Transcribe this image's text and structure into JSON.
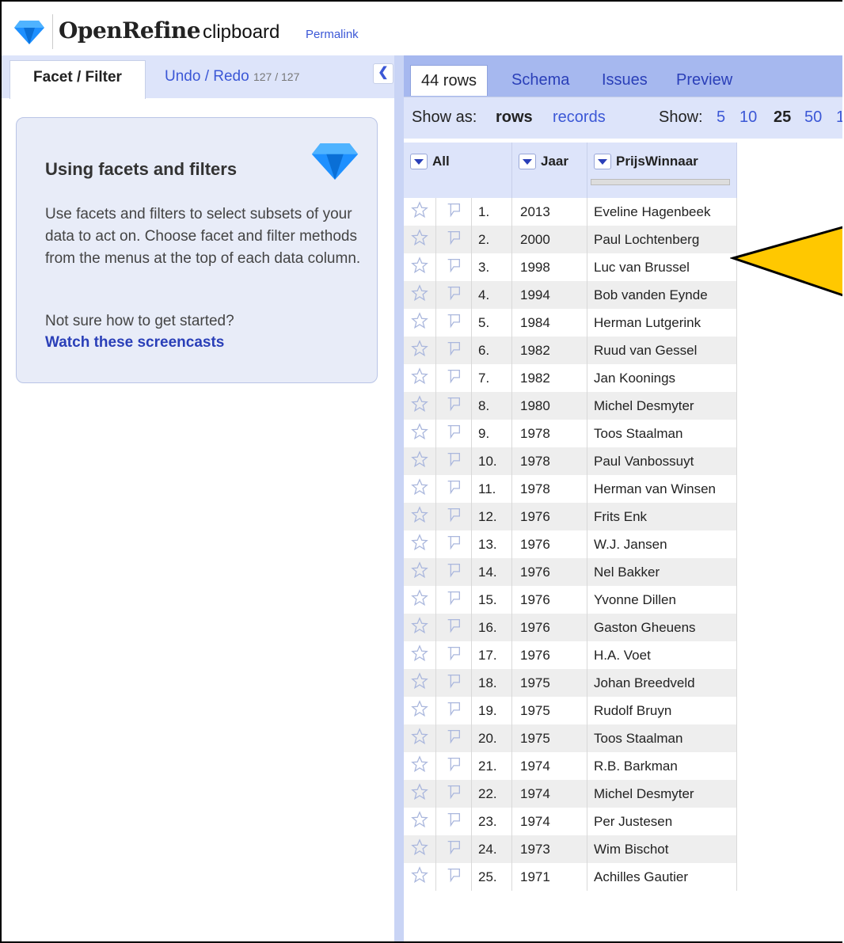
{
  "header": {
    "app_name": "OpenRefine",
    "project_name": "clipboard",
    "permalink": "Permalink"
  },
  "left_panel": {
    "tab_facet": "Facet / Filter",
    "tab_undo": "Undo / Redo",
    "undo_count": "127 / 127",
    "collapse_icon": "chevron-left-icon",
    "help": {
      "title": "Using facets and filters",
      "body": "Use facets and filters to select subsets of your data to act on. Choose facet and filter methods from the menus at the top of each data column.",
      "question": "Not sure how to get started?",
      "link": "Watch these screencasts"
    }
  },
  "right_panel": {
    "tabs": {
      "rows": "44 rows",
      "schema": "Schema",
      "issues": "Issues",
      "preview": "Preview"
    },
    "viewbar": {
      "show_as_label": "Show as:",
      "rows": "rows",
      "records": "records",
      "show_label": "Show:",
      "opt5": "5",
      "opt10": "10",
      "opt25": "25",
      "opt50": "50",
      "opt_more": "1"
    },
    "columns": {
      "all": "All",
      "jaar": "Jaar",
      "prijswinnaar": "PrijsWinnaar"
    },
    "rows": [
      {
        "n": "1.",
        "jaar": "2013",
        "naam": "Eveline Hagenbeek"
      },
      {
        "n": "2.",
        "jaar": "2000",
        "naam": "Paul Lochtenberg"
      },
      {
        "n": "3.",
        "jaar": "1998",
        "naam": "Luc van Brussel"
      },
      {
        "n": "4.",
        "jaar": "1994",
        "naam": "Bob vanden Eynde"
      },
      {
        "n": "5.",
        "jaar": "1984",
        "naam": "Herman Lutgerink"
      },
      {
        "n": "6.",
        "jaar": "1982",
        "naam": "Ruud van Gessel"
      },
      {
        "n": "7.",
        "jaar": "1982",
        "naam": "Jan Koonings"
      },
      {
        "n": "8.",
        "jaar": "1980",
        "naam": "Michel Desmyter"
      },
      {
        "n": "9.",
        "jaar": "1978",
        "naam": "Toos Staalman"
      },
      {
        "n": "10.",
        "jaar": "1978",
        "naam": "Paul Vanbossuyt"
      },
      {
        "n": "11.",
        "jaar": "1978",
        "naam": "Herman van Winsen"
      },
      {
        "n": "12.",
        "jaar": "1976",
        "naam": "Frits Enk"
      },
      {
        "n": "13.",
        "jaar": "1976",
        "naam": "W.J. Jansen"
      },
      {
        "n": "14.",
        "jaar": "1976",
        "naam": "Nel Bakker"
      },
      {
        "n": "15.",
        "jaar": "1976",
        "naam": "Yvonne Dillen"
      },
      {
        "n": "16.",
        "jaar": "1976",
        "naam": "Gaston Gheuens"
      },
      {
        "n": "17.",
        "jaar": "1976",
        "naam": "H.A. Voet"
      },
      {
        "n": "18.",
        "jaar": "1975",
        "naam": "Johan Breedveld"
      },
      {
        "n": "19.",
        "jaar": "1975",
        "naam": "Rudolf Bruyn"
      },
      {
        "n": "20.",
        "jaar": "1975",
        "naam": "Toos Staalman"
      },
      {
        "n": "21.",
        "jaar": "1974",
        "naam": "R.B. Barkman"
      },
      {
        "n": "22.",
        "jaar": "1974",
        "naam": "Michel Desmyter"
      },
      {
        "n": "23.",
        "jaar": "1974",
        "naam": "Per Justesen"
      },
      {
        "n": "24.",
        "jaar": "1973",
        "naam": "Wim Bischot"
      },
      {
        "n": "25.",
        "jaar": "1971",
        "naam": "Achilles Gautier"
      }
    ]
  },
  "colors": {
    "accent": "#3b57d6",
    "tab_bar": "#a6b8ef",
    "panel_bg": "#dde4fa",
    "arrow_fill": "#ffc800"
  }
}
